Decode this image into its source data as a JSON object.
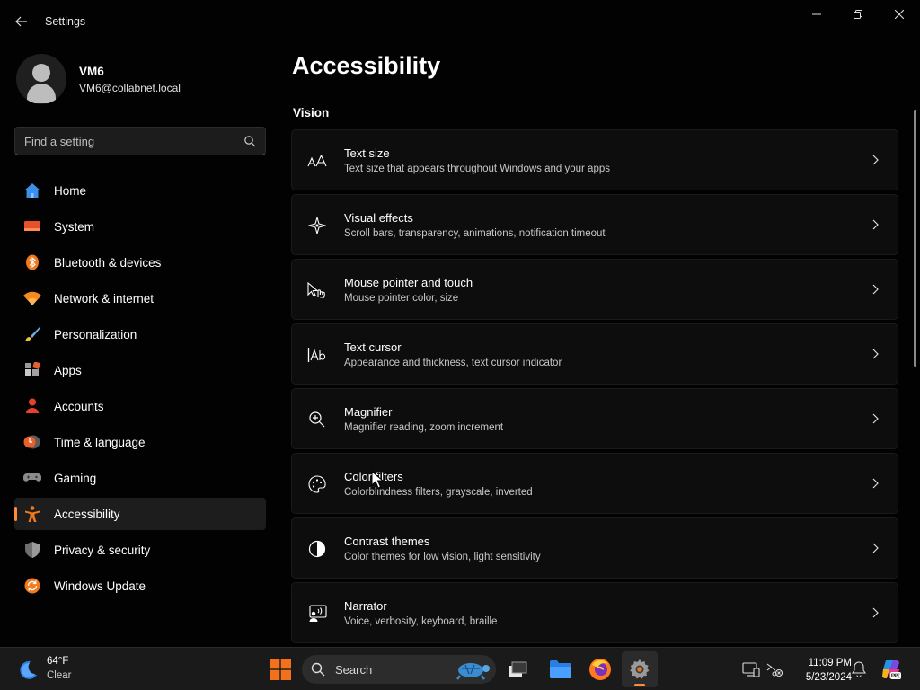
{
  "window": {
    "title": "Settings"
  },
  "profile": {
    "name": "VM6",
    "email": "VM6@collabnet.local"
  },
  "search": {
    "placeholder": "Find a setting"
  },
  "accent": "#ff8a3d",
  "nav": [
    {
      "label": "Home",
      "icon": "home-icon"
    },
    {
      "label": "System",
      "icon": "system-icon"
    },
    {
      "label": "Bluetooth & devices",
      "icon": "bluetooth-icon"
    },
    {
      "label": "Network & internet",
      "icon": "network-icon"
    },
    {
      "label": "Personalization",
      "icon": "brush-icon"
    },
    {
      "label": "Apps",
      "icon": "apps-icon"
    },
    {
      "label": "Accounts",
      "icon": "accounts-icon"
    },
    {
      "label": "Time & language",
      "icon": "clock-globe-icon"
    },
    {
      "label": "Gaming",
      "icon": "gamepad-icon"
    },
    {
      "label": "Accessibility",
      "icon": "accessibility-icon",
      "active": true
    },
    {
      "label": "Privacy & security",
      "icon": "shield-icon"
    },
    {
      "label": "Windows Update",
      "icon": "update-icon"
    }
  ],
  "main": {
    "title": "Accessibility",
    "section": "Vision",
    "cards": [
      {
        "title": "Text size",
        "desc": "Text size that appears throughout Windows and your apps",
        "icon": "text-size-icon"
      },
      {
        "title": "Visual effects",
        "desc": "Scroll bars, transparency, animations, notification timeout",
        "icon": "sparkle-icon"
      },
      {
        "title": "Mouse pointer and touch",
        "desc": "Mouse pointer color, size",
        "icon": "pointer-touch-icon"
      },
      {
        "title": "Text cursor",
        "desc": "Appearance and thickness, text cursor indicator",
        "icon": "text-cursor-icon"
      },
      {
        "title": "Magnifier",
        "desc": "Magnifier reading, zoom increment",
        "icon": "magnifier-icon"
      },
      {
        "title": "Color filters",
        "desc": "Colorblindness filters, grayscale, inverted",
        "icon": "palette-icon"
      },
      {
        "title": "Contrast themes",
        "desc": "Color themes for low vision, light sensitivity",
        "icon": "contrast-icon"
      },
      {
        "title": "Narrator",
        "desc": "Voice, verbosity, keyboard, braille",
        "icon": "narrator-icon"
      }
    ]
  },
  "taskbar": {
    "weather": {
      "temp": "64°F",
      "condition": "Clear"
    },
    "search_label": "Search",
    "clock": {
      "time": "11:09 PM",
      "date": "5/23/2024"
    }
  }
}
